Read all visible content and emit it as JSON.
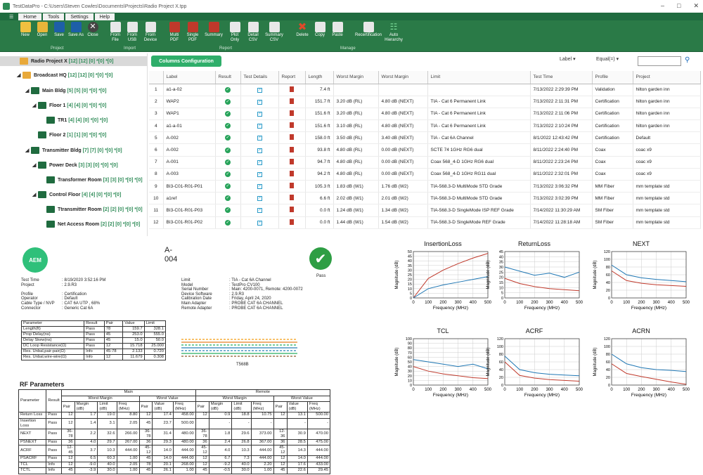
{
  "window": {
    "title": "TestDataPro - C:\\Users\\Steven Cowles\\Documents\\Projects\\Radio Project X.tpp"
  },
  "menu": {
    "tabs": [
      "Home",
      "Tools",
      "Settings",
      "Help"
    ]
  },
  "ribbon": {
    "project_buttons": [
      "New",
      "Open",
      "Save",
      "Save As",
      "Close"
    ],
    "import_buttons": [
      "From File",
      "From USB",
      "From Device"
    ],
    "report_buttons": [
      "Multi PDF",
      "Single PDF",
      "Summary",
      "Plot Only",
      "Detail CSV",
      "Summary CSV"
    ],
    "manage_buttons": [
      "Delete",
      "Copy",
      "Paste",
      "Recertification",
      "Auto Hierarchy"
    ],
    "groups": [
      "Project",
      "Import",
      "Report",
      "Manage"
    ]
  },
  "tree": [
    {
      "label": "Radio Project X",
      "counts": "[12] [12] [0] *[0] *[0]"
    },
    {
      "label": "Broadcast HQ",
      "counts": "[12] [12] [0] *[0] *[0]"
    },
    {
      "label": "Main Bldg",
      "counts": "[5] [5] [0] *[0] *[0]"
    },
    {
      "label": "Floor 1",
      "counts": "[4] [4] [0] *[0] *[0]"
    },
    {
      "label": "TR1",
      "counts": "[4] [4] [0] *[0] *[0]"
    },
    {
      "label": "Floor 2",
      "counts": "[1] [1] [0] *[0] *[0]"
    },
    {
      "label": "Transmitter Bldg",
      "counts": "[7] [7] [0] *[0] *[0]"
    },
    {
      "label": "Power Deck",
      "counts": "[3] [3] [0] *[0] *[0]"
    },
    {
      "label": "Transformer Room",
      "counts": "[3] [3] [0] *[0] *[0]"
    },
    {
      "label": "Control Floor",
      "counts": "[4] [4] [0] *[0] *[0]"
    },
    {
      "label": "Ttransmitter Room",
      "counts": "[2] [2] [0] *[0] *[0]"
    },
    {
      "label": "Net Access Room",
      "counts": "[2] [2] [0] *[0] *[0]"
    }
  ],
  "toolbar": {
    "columns_button": "Columns Configuration",
    "filter_field": "Label",
    "filter_op": "Equal(=)",
    "search_placeholder": ""
  },
  "grid": {
    "headers": [
      "",
      "Label",
      "Result",
      "Test Details",
      "Report",
      "Length",
      "Worst Margin",
      "Worst Margin",
      "Limit",
      "Test Time",
      "Profile",
      "Project"
    ],
    "rows": [
      [
        "1",
        "a1-a-02",
        "7.4 ft",
        "",
        "",
        "",
        "7/13/2022 2:29:39 PM",
        "Validation",
        "hilton garden inn"
      ],
      [
        "2",
        "WAP2",
        "151.7 ft",
        "3.20 dB (RL)",
        "4.80 dB (NEXT)",
        "TIA - Cat 6 Permanent Link",
        "7/13/2022 2:11:31 PM",
        "Certification",
        "hilton garden inn"
      ],
      [
        "3",
        "WAP1",
        "151.6 ft",
        "3.20 dB (RL)",
        "4.80 dB (NEXT)",
        "TIA - Cat 6 Permanent Link",
        "7/13/2022 2:11:06 PM",
        "Certification",
        "hilton garden inn"
      ],
      [
        "4",
        "a1-a-01",
        "151.6 ft",
        "3.10 dB (RL)",
        "4.80 dB (NEXT)",
        "TIA - Cat 6 Permanent Link",
        "7/13/2022 2:10:24 PM",
        "Certification",
        "hilton garden inn"
      ],
      [
        "5",
        "A-002",
        "158.0 ft",
        "3.50 dB (RL)",
        "3.40 dB (NEXT)",
        "TIA - Cat 6A Channel",
        "8/1/2022 12:43:42 PM",
        "Certification",
        "Default"
      ],
      [
        "6",
        "A-002",
        "93.8 ft",
        "4.80 dB (RL)",
        "0.00 dB (NEXT)",
        "SCTE 74 1GHz RG6 dual",
        "8/11/2022 2:24:40 PM",
        "Coax",
        "coac x9"
      ],
      [
        "7",
        "A-001",
        "94.7 ft",
        "4.80 dB (RL)",
        "0.00 dB (NEXT)",
        "Coax 568_4-D 1GHz RG6 dual",
        "8/11/2022 2:23:24 PM",
        "Coax",
        "coac x9"
      ],
      [
        "8",
        "A-003",
        "94.2 ft",
        "4.80 dB (RL)",
        "0.00 dB (NEXT)",
        "Coax 568_4-D 1GHz RG11 dual",
        "8/11/2022 2:32:01 PM",
        "Coax",
        "coac x9"
      ],
      [
        "9",
        "BI3-C01-R01-P01",
        "105.3 ft",
        "1.83 dB (W1)",
        "1.76 dB (W2)",
        "TIA-568.3-D MultiMode STD Grade",
        "7/13/2022 3:06:32 PM",
        "MM Fiber",
        "mm template std"
      ],
      [
        "10",
        "a1ref",
        "6.6 ft",
        "2.02 dB (W1)",
        "2.01 dB (W2)",
        "TIA-568.3-D MultiMode STD Grade",
        "7/13/2022 3:02:39 PM",
        "MM Fiber",
        "mm template std"
      ],
      [
        "11",
        "BI3-C01-R01-P03",
        "0.0 ft",
        "1.24 dB (W1)",
        "1.34 dB (W2)",
        "TIA-568.3-D SingleMode ISP REF Grade",
        "7/14/2022 11:30:29 AM",
        "SM Fiber",
        "mm template std"
      ],
      [
        "12",
        "BI3-C01-R01-P02",
        "0.0 ft",
        "1.44 dB (W1)",
        "1.54 dB (W2)",
        "TIA-568.3-D SingleMode REF Grade",
        "7/14/2022 11:28:18 AM",
        "SM Fiber",
        "mm template std"
      ]
    ]
  },
  "report": {
    "logo": "AEM",
    "name_line1": "A-",
    "name_line2": "004",
    "pass_label": "Pass",
    "info_left": [
      [
        "Test Time",
        ": 8/19/2020 3:52:16 PM"
      ],
      [
        "Project",
        ": 2.9.R3"
      ],
      [
        "",
        ""
      ],
      [
        "Profile",
        ": Certification"
      ],
      [
        "Operator",
        ": Default"
      ],
      [
        "Cable Type / NVP",
        ": CAT 6A UTP , 68%"
      ],
      [
        "Connector",
        ": Generic Cat 6A"
      ]
    ],
    "info_right": [
      [
        "Limit",
        ": TIA - Cat 6A Channel"
      ],
      [
        "Model",
        ": TestPro CV100"
      ],
      [
        "Serial Number",
        ": Main: 4200-0071, Remote: 4200-0072"
      ],
      [
        "Device Software",
        ": 2.9.R3"
      ],
      [
        "Calibration Date",
        ": Friday, April 24, 2020"
      ],
      [
        "Main Adapter",
        ": PROBE CAT 6A CHANNEL"
      ],
      [
        "Remote Adapter",
        ": PROBE CAT 6A CHANNEL"
      ]
    ],
    "param_table": {
      "headers": [
        "Parameter",
        "Result",
        "Pair",
        "Value",
        "Limit"
      ],
      "rows": [
        [
          "Length(ft)",
          "Pass",
          "78",
          "159.7",
          "328.1"
        ],
        [
          "Prop Delay(ns)",
          "Pass",
          "45",
          "253.0",
          "555.0"
        ],
        [
          "Delay Skew(ns)",
          "Pass",
          "45",
          "15.0",
          "50.0"
        ],
        [
          "DC Loop Resistance(Ω)",
          "Pass",
          "12",
          "15.718",
          "25.000"
        ],
        [
          "Res. Unbal,pair-pair(Ω)",
          "Info",
          "45-78",
          "2.133",
          "0.720"
        ],
        [
          "Res. Unbal,wire-wire(Ω)",
          "Info",
          "12",
          "11.679",
          "0.308"
        ]
      ]
    },
    "wiremap_label": "T568B",
    "rf_title": "RF Parameters",
    "rf_header": {
      "parameter": "Parameter",
      "result": "Result",
      "main": "Main",
      "remote": "Remote",
      "worst_margin": "Worst Margin",
      "worst_value": "Worst Value",
      "sub": [
        "Pair",
        "Margin (dB)",
        "Limit (dB)",
        "Freq (MHz)",
        "Pair",
        "Value (dB)",
        "Freq (MHz)",
        "Pair",
        "Margin (dB)",
        "Limit (dB)",
        "Freq (MHz)",
        "Pair",
        "Value (dB)",
        "Freq (MHz)"
      ]
    },
    "rf_rows": [
      [
        "Return Loss",
        "Pass",
        "12",
        "1.7",
        "19.0",
        "8.80",
        "12",
        "17.4",
        "458.00",
        "12",
        "0.9",
        "18.8",
        "10.75",
        "12",
        "13.1",
        "500.00"
      ],
      [
        "Insertion Loss",
        "Pass",
        "12",
        "1.4",
        "3.1",
        "2.05",
        "45",
        "23.7",
        "500.00",
        "",
        "-",
        "-",
        "-",
        "",
        "-",
        "-"
      ],
      [
        "NEXT",
        "Pass",
        "36-78",
        "2.2",
        "32.6",
        "266.00",
        "36-78",
        "31.4",
        "480.00",
        "36-78",
        "1.8",
        "29.6",
        "373.00",
        "12-36",
        "30.9",
        "470.00"
      ],
      [
        "PSNEXT",
        "Pass",
        "36",
        "4.0",
        "29.7",
        "267.00",
        "36",
        "29.3",
        "480.00",
        "36",
        "2.4",
        "26.8",
        "367.00",
        "36",
        "28.5",
        "475.00"
      ],
      [
        "ACRF",
        "Pass",
        "12-45",
        "3.7",
        "10.3",
        "444.00",
        "45-12",
        "14.0",
        "444.00",
        "45-12",
        "4.0",
        "10.3",
        "444.00",
        "45-12",
        "14.3",
        "444.00"
      ],
      [
        "PSACRF",
        "Pass",
        "12",
        "6.5",
        "60.3",
        "1.00",
        "45",
        "14.0",
        "444.00",
        "12",
        "6.7",
        "7.3",
        "444.00",
        "12",
        "14.0",
        "444.00"
      ],
      [
        "TCL",
        "Info",
        "12",
        "-9.0",
        "40.0",
        "2.05",
        "78",
        "20.1",
        "268.00",
        "12",
        "-9.2",
        "40.0",
        "2.20",
        "12",
        "17.6",
        "433.00"
      ],
      [
        "TCTL",
        "Info",
        "45",
        "-3.9",
        "30.0",
        "1.00",
        "45",
        "26.1",
        "1.00",
        "45",
        "-0.5",
        "30.0",
        "1.00",
        "45",
        "22.6",
        "29.45"
      ]
    ]
  },
  "chart_data": [
    {
      "type": "line",
      "title": "InsertionLoss",
      "xlabel": "Frequency (MHz)",
      "ylabel": "Magnitude (dB)",
      "xlim": [
        0,
        500
      ],
      "ylim": [
        0,
        50
      ],
      "xticks": [
        0,
        100,
        200,
        300,
        400,
        500
      ],
      "yticks": [
        0,
        5,
        10,
        15,
        20,
        25,
        30,
        35,
        40,
        45,
        50
      ],
      "series": [
        {
          "color": "#c0392b",
          "x": [
            0,
            100,
            200,
            300,
            400,
            500
          ],
          "y": [
            0,
            21,
            30,
            37,
            43,
            48
          ]
        },
        {
          "color": "#1f77b4",
          "x": [
            0,
            100,
            200,
            300,
            400,
            500
          ],
          "y": [
            0,
            10,
            14,
            17,
            20,
            23
          ]
        }
      ]
    },
    {
      "type": "line",
      "title": "ReturnLoss",
      "xlabel": "Frequency (MHz)",
      "ylabel": "Magnitude (dB)",
      "xlim": [
        0,
        500
      ],
      "ylim": [
        0,
        45
      ],
      "xticks": [
        0,
        100,
        200,
        300,
        400,
        500
      ],
      "yticks": [
        0,
        5,
        10,
        15,
        20,
        25,
        30,
        35,
        40,
        45
      ],
      "series": [
        {
          "color": "#c0392b",
          "x": [
            0,
            100,
            200,
            300,
            400,
            500
          ],
          "y": [
            19,
            14,
            11,
            9,
            8,
            7
          ]
        },
        {
          "color": "#1f77b4",
          "x": [
            0,
            100,
            200,
            300,
            400,
            500
          ],
          "y": [
            30,
            26,
            22,
            24,
            20,
            25
          ]
        }
      ]
    },
    {
      "type": "line",
      "title": "NEXT",
      "xlabel": "Frequency (MHz)",
      "ylabel": "Magnitude (dB)",
      "xlim": [
        0,
        500
      ],
      "ylim": [
        0,
        120
      ],
      "xticks": [
        0,
        100,
        200,
        300,
        400,
        500
      ],
      "yticks": [
        0,
        20,
        40,
        60,
        80,
        100,
        120
      ],
      "series": [
        {
          "color": "#c0392b",
          "x": [
            0,
            100,
            200,
            300,
            400,
            500
          ],
          "y": [
            70,
            45,
            38,
            34,
            32,
            30
          ]
        },
        {
          "color": "#1f77b4",
          "x": [
            0,
            100,
            200,
            300,
            400,
            500
          ],
          "y": [
            85,
            60,
            52,
            48,
            45,
            42
          ]
        }
      ]
    },
    {
      "type": "line",
      "title": "TCL",
      "xlabel": "Frequency (MHz)",
      "ylabel": "Magnitude (dB)",
      "xlim": [
        0,
        500
      ],
      "ylim": [
        0,
        100
      ],
      "xticks": [
        0,
        100,
        200,
        300,
        400,
        500
      ],
      "yticks": [
        0,
        10,
        20,
        30,
        40,
        50,
        60,
        70,
        80,
        90,
        100
      ],
      "series": [
        {
          "color": "#c0392b",
          "x": [
            0,
            100,
            200,
            300,
            400,
            500
          ],
          "y": [
            40,
            30,
            24,
            20,
            16,
            14
          ]
        },
        {
          "color": "#1f77b4",
          "x": [
            0,
            100,
            200,
            300,
            400,
            500
          ],
          "y": [
            55,
            50,
            45,
            40,
            45,
            35
          ]
        }
      ]
    },
    {
      "type": "line",
      "title": "ACRF",
      "xlabel": "Frequency (MHz)",
      "ylabel": "Magnitude (dB)",
      "xlim": [
        0,
        500
      ],
      "ylim": [
        0,
        120
      ],
      "xticks": [
        0,
        100,
        200,
        300,
        400,
        500
      ],
      "yticks": [
        0,
        20,
        40,
        60,
        80,
        100,
        120
      ],
      "series": [
        {
          "color": "#c0392b",
          "x": [
            0,
            100,
            200,
            300,
            400,
            500
          ],
          "y": [
            60,
            25,
            18,
            14,
            12,
            10
          ]
        },
        {
          "color": "#1f77b4",
          "x": [
            0,
            100,
            200,
            300,
            400,
            500
          ],
          "y": [
            75,
            40,
            32,
            28,
            26,
            24
          ]
        }
      ]
    },
    {
      "type": "line",
      "title": "ACRN",
      "xlabel": "Frequency (MHz)",
      "ylabel": "Magnitude (dB)",
      "xlim": [
        0,
        500
      ],
      "ylim": [
        0,
        120
      ],
      "xticks": [
        0,
        100,
        200,
        300,
        400,
        500
      ],
      "yticks": [
        0,
        20,
        40,
        60,
        80,
        100,
        120
      ],
      "series": [
        {
          "color": "#c0392b",
          "x": [
            0,
            100,
            200,
            300,
            400,
            500
          ],
          "y": [
            55,
            30,
            22,
            15,
            8,
            2
          ]
        },
        {
          "color": "#1f77b4",
          "x": [
            0,
            100,
            200,
            300,
            400,
            500
          ],
          "y": [
            80,
            55,
            45,
            40,
            38,
            35
          ]
        }
      ]
    }
  ]
}
